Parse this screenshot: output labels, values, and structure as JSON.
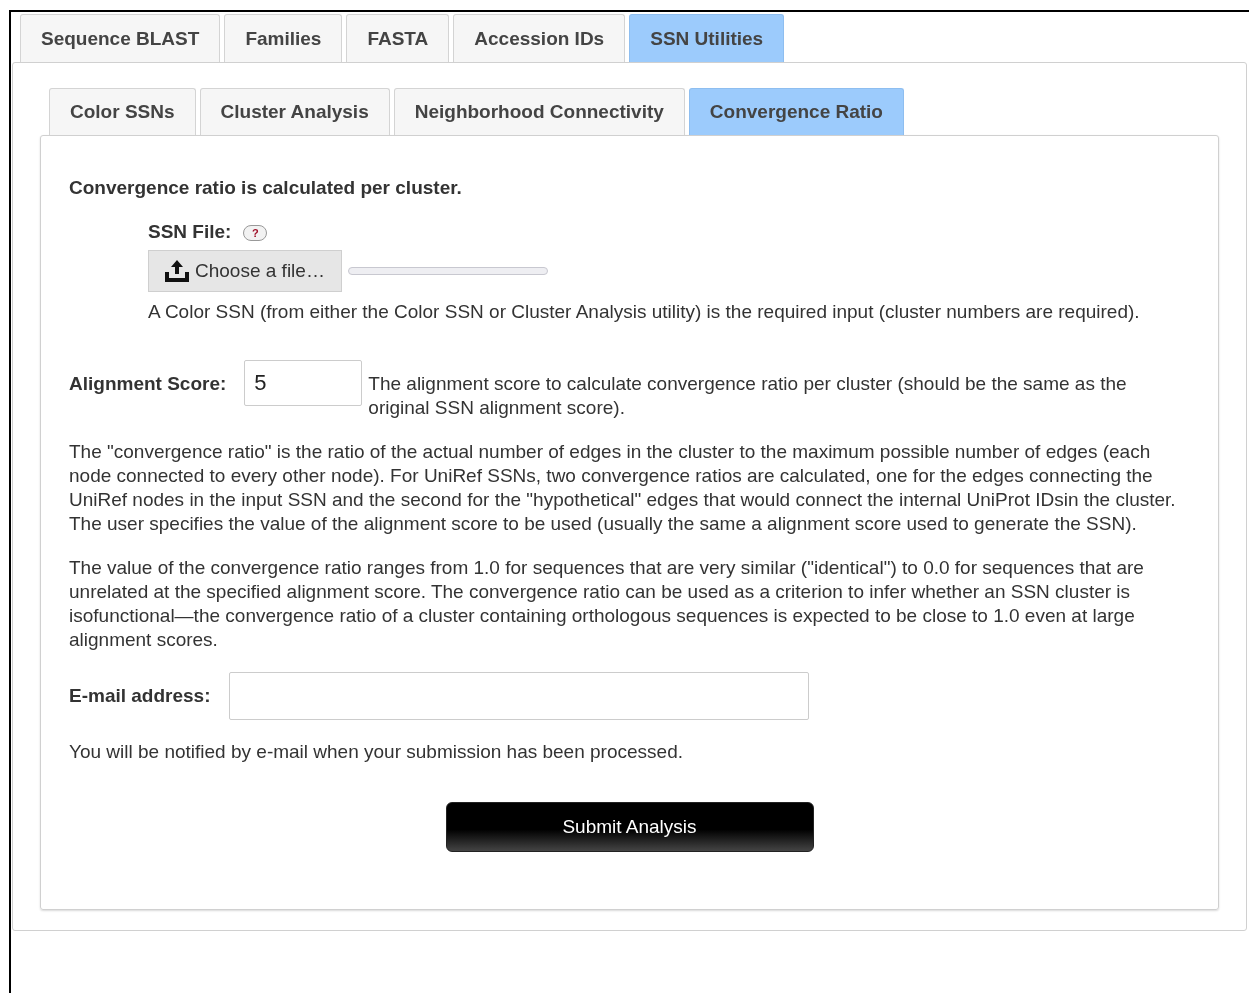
{
  "main_tabs": [
    {
      "label": "Sequence BLAST",
      "selected": false
    },
    {
      "label": "Families",
      "selected": false
    },
    {
      "label": "FASTA",
      "selected": false
    },
    {
      "label": "Accession IDs",
      "selected": false
    },
    {
      "label": "SSN Utilities",
      "selected": true
    }
  ],
  "sub_tabs": [
    {
      "label": "Color SSNs",
      "selected": false
    },
    {
      "label": "Cluster Analysis",
      "selected": false
    },
    {
      "label": "Neighborhood Connectivity",
      "selected": false
    },
    {
      "label": "Convergence Ratio",
      "selected": true
    }
  ],
  "heading": "Convergence ratio is calculated per cluster.",
  "ssn_file": {
    "label": "SSN File:",
    "help": "?",
    "button": "Choose a file…",
    "description": "A Color SSN (from either the Color SSN or Cluster Analysis utility) is the required input (cluster numbers are required)."
  },
  "alignment_score": {
    "label": "Alignment Score:",
    "value": "5",
    "description": "The alignment score to calculate convergence ratio per cluster (should be the same as the original SSN alignment score)."
  },
  "paragraphs": [
    "The \"convergence ratio\" is the ratio of the actual number of edges in the cluster to the maximum possible number of edges (each node connected to every other node). For UniRef SSNs, two convergence ratios are calculated, one for the edges connecting the UniRef nodes in the input SSN and the second for the \"hypothetical\" edges that would connect the internal UniProt IDsin the cluster. The user specifies the value of the alignment score to be used (usually the same a alignment score used to generate the SSN).",
    "The value of the convergence ratio ranges from 1.0 for sequences that are very similar (\"identical\") to 0.0 for sequences that are unrelated at the specified alignment score. The convergence ratio can be used as a criterion to infer whether an SSN cluster is isofunctional—the convergence ratio of a cluster containing orthologous sequences is expected to be close to 1.0 even at large alignment scores."
  ],
  "email": {
    "label": "E-mail address:",
    "note": "You will be notified by e-mail when your submission has been processed."
  },
  "submit_button": "Submit Analysis"
}
